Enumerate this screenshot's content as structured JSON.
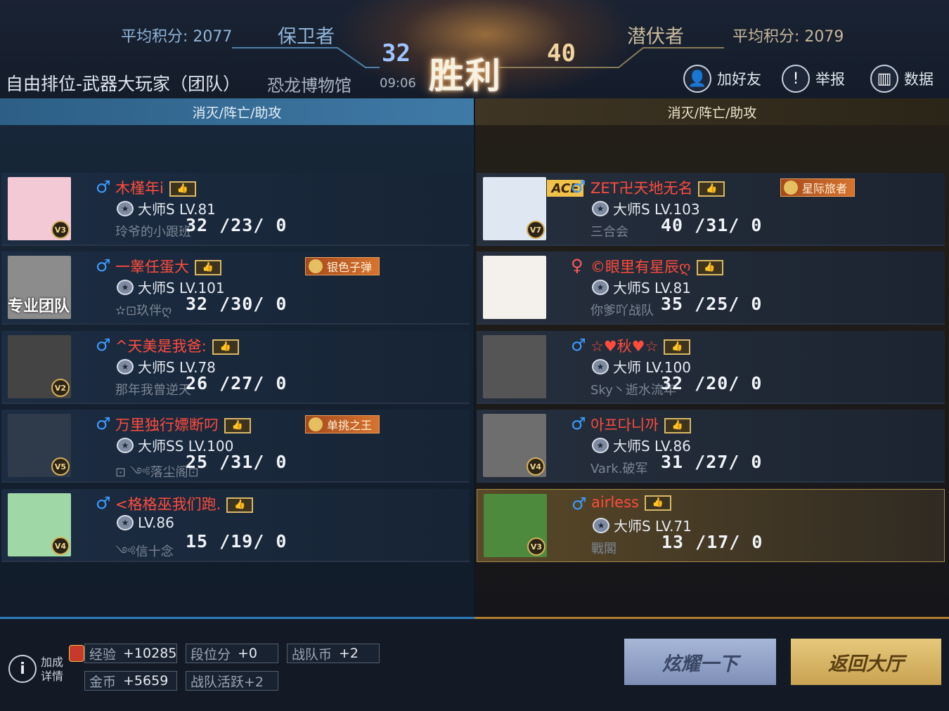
{
  "header": {
    "left_avg_label": "平均积分: 2077",
    "left_side": "保卫者",
    "right_side": "潜伏者",
    "right_avg_label": "平均积分: 2079",
    "left_score": "32",
    "victory": "胜利",
    "right_score": "40",
    "mode": "自由排位-武器大玩家（团队）",
    "map": "恐龙博物馆",
    "time": "09:06"
  },
  "top_buttons": {
    "add_friend": "加好友",
    "report": "举报",
    "stats": "数据"
  },
  "columns": {
    "left_header": "消灭/阵亡/助攻",
    "right_header": "消灭/阵亡/助攻"
  },
  "left_team": [
    {
      "gender": "male",
      "name": "木槿年i",
      "rank": "大师S LV.81",
      "sub": "玲爷的小跟班",
      "kda": "32 /23/  0",
      "vip": "V3",
      "avatar_color": "#f3c9d6",
      "badge": ""
    },
    {
      "gender": "male",
      "name": "一睾任蛋大",
      "rank": "大师S LV.101",
      "sub": "✫⊡玖伴ღ",
      "kda": "32 /30/  0",
      "vip": "",
      "avatar_color": "#8c8c8c",
      "avatar_text": "专业团队",
      "badge": "银色子弹"
    },
    {
      "gender": "male",
      "name": "^天美是我爸:",
      "rank": "大师S LV.78",
      "sub": "那年我曾逆天",
      "kda": "26 /27/  0",
      "vip": "V2",
      "avatar_color": "#444444",
      "badge": ""
    },
    {
      "gender": "male",
      "name": "万里独行嫖断叼",
      "rank": "大师SS LV.100",
      "sub": "⊡ ༺落尘阁⊡",
      "kda": "25 /31/  0",
      "vip": "V5",
      "avatar_color": "#2f3a4a",
      "badge": "单挑之王"
    },
    {
      "gender": "male",
      "name": "<格格巫我们跑.",
      "rank": "LV.86",
      "sub": "༺信十念",
      "kda": "15  /19/  0",
      "vip": "V4",
      "avatar_color": "#9fd8a6",
      "badge": ""
    }
  ],
  "right_team": [
    {
      "gender": "male",
      "name": "ZET卍天地无名",
      "rank": "大师S LV.103",
      "sub": "三合会",
      "kda": "40 /31/  0",
      "vip": "V7",
      "avatar_color": "#dfe8f2",
      "ace": "ACE",
      "badge": "星际旅者"
    },
    {
      "gender": "female",
      "name": "©眼里有星辰ღ",
      "rank": "大师S LV.81",
      "sub": "你爹吖战队",
      "kda": "35 /25/  0",
      "vip": "",
      "avatar_color": "#f4f1ec",
      "badge": ""
    },
    {
      "gender": "male",
      "name": "☆♥秋♥☆",
      "rank": "大师 LV.100",
      "sub": "Sky丶逝水流年",
      "kda": "32 /20/  0",
      "vip": "",
      "avatar_color": "#555555",
      "badge": ""
    },
    {
      "gender": "male",
      "name": "아프다니까",
      "rank": "大师S LV.86",
      "sub": "Vark.破军",
      "kda": "31  /27/  0",
      "vip": "V4",
      "avatar_color": "#6e6e6e",
      "badge": ""
    },
    {
      "gender": "male",
      "name": "airless",
      "rank": "大师S LV.71",
      "sub": "戰閣",
      "kda": "13  /17/  0",
      "vip": "V3",
      "avatar_color": "#4d8a3e",
      "badge": "",
      "mvp": true
    }
  ],
  "bonus": {
    "detail_label": "加成\n详情",
    "exp_label": "经验",
    "exp_value": "+10285",
    "rank_label": "段位分",
    "rank_value": "+0",
    "team_coin_label": "战队币",
    "team_coin_value": "+2",
    "gold_label": "金币",
    "gold_value": "+5659",
    "activity_label": "战队活跃+2"
  },
  "buttons": {
    "show_off": "炫耀一下",
    "back_lobby": "返回大厅"
  },
  "colors": {
    "left_team_accent": "#3f7aa6",
    "right_team_accent": "#b27b2d",
    "name_red": "#ff4c3c",
    "male_blue": "#3d9cff"
  }
}
